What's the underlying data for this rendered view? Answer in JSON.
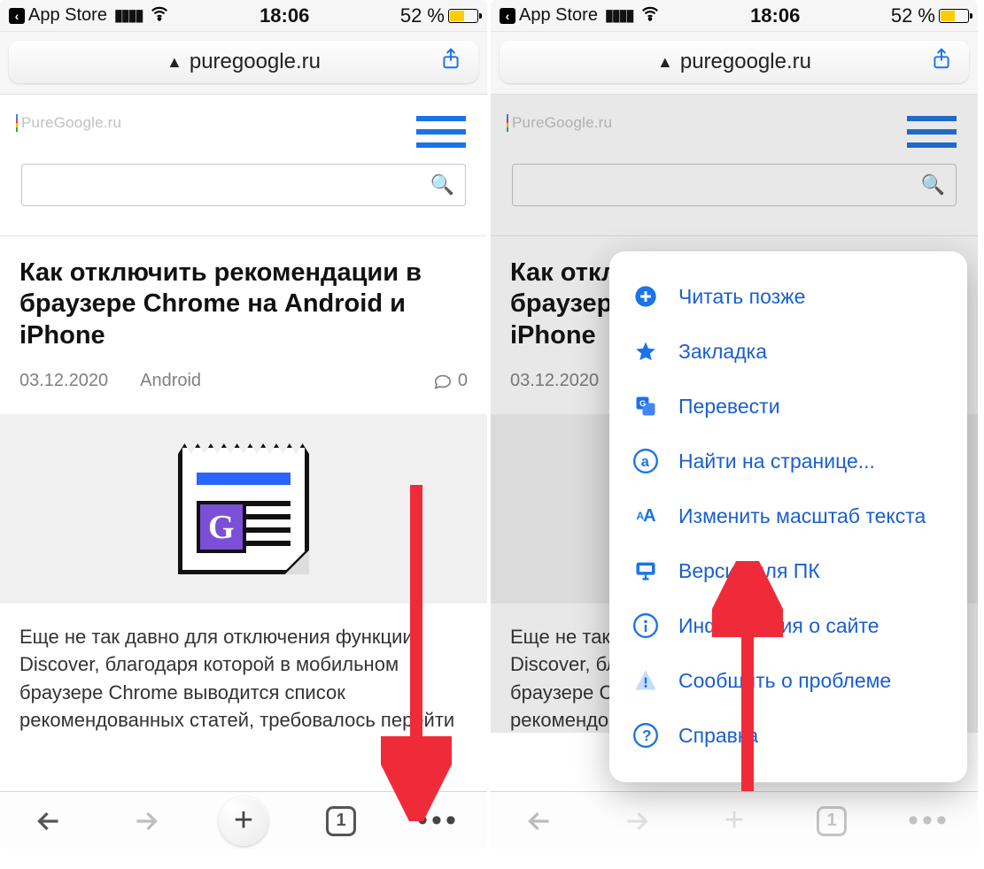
{
  "status": {
    "back_app": "App Store",
    "time": "18:06",
    "battery_pct": "52 %"
  },
  "url": "puregoogle.ru",
  "site": {
    "logo": "PureGoogle.ru"
  },
  "article": {
    "title": "Как отключить рекомендации в браузере Chrome на Android и iPhone",
    "date": "03.12.2020",
    "category": "Android",
    "comments": "0",
    "body": "Еще не так давно для отключения функции Discover, благодаря которой в мобильном браузере Chrome выводится список рекомендованных статей, требовалось перейти на скрытую страницу с экспериментальными настройками, найти соответствующий"
  },
  "toolbar": {
    "tabs": "1"
  },
  "menu": {
    "read_later": "Читать позже",
    "bookmark": "Закладка",
    "translate": "Перевести",
    "find": "Найти на странице...",
    "text_size": "Изменить масштаб текста",
    "desktop": "Версия для ПК",
    "site_info": "Информация о сайте",
    "report": "Сообщить о проблеме",
    "help": "Справка"
  }
}
